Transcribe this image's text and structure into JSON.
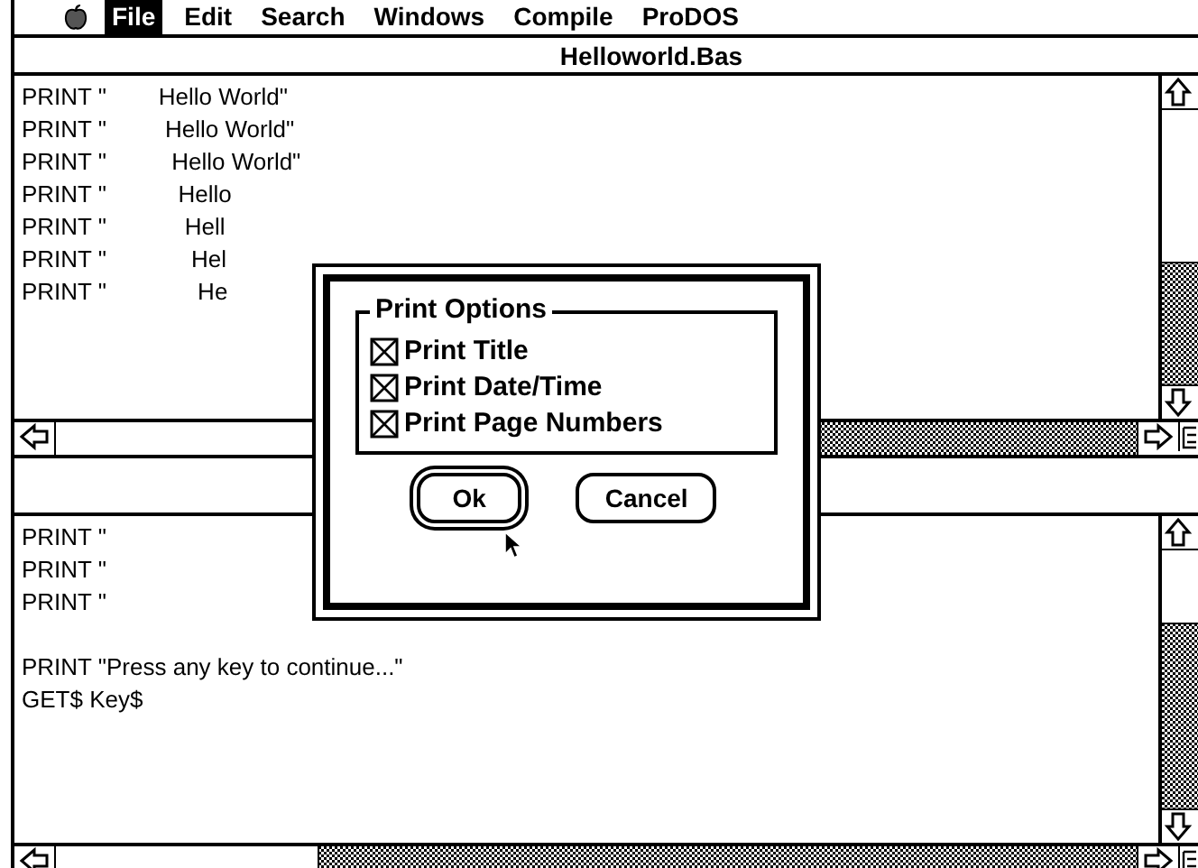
{
  "menu_bar": {
    "items": [
      {
        "label": "File",
        "selected": true
      },
      {
        "label": "Edit",
        "selected": false
      },
      {
        "label": "Search",
        "selected": false
      },
      {
        "label": "Windows",
        "selected": false
      },
      {
        "label": "Compile",
        "selected": false
      },
      {
        "label": "ProDOS",
        "selected": false
      }
    ]
  },
  "top_window": {
    "title": "Helloworld.Bas",
    "lines": [
      "PRINT \"        Hello World\"",
      "PRINT \"         Hello World\"",
      "PRINT \"          Hello World\"",
      "PRINT \"           Hello",
      "PRINT \"            Hell",
      "PRINT \"             Hel",
      "PRINT \"              He"
    ]
  },
  "bottom_window": {
    "lines": [
      "PRINT \"",
      "PRINT \"",
      "PRINT \""
    ],
    "more_lines": [
      "PRINT \"Press any key to continue...\"",
      "GET$ Key$"
    ]
  },
  "dialog": {
    "group_title": "Print Options",
    "options": [
      {
        "label": "Print Title",
        "checked": true
      },
      {
        "label": "Print Date/Time",
        "checked": true
      },
      {
        "label": "Print Page Numbers",
        "checked": true
      }
    ],
    "buttons": [
      {
        "label": "Ok",
        "default": true
      },
      {
        "label": "Cancel",
        "default": false
      }
    ]
  }
}
